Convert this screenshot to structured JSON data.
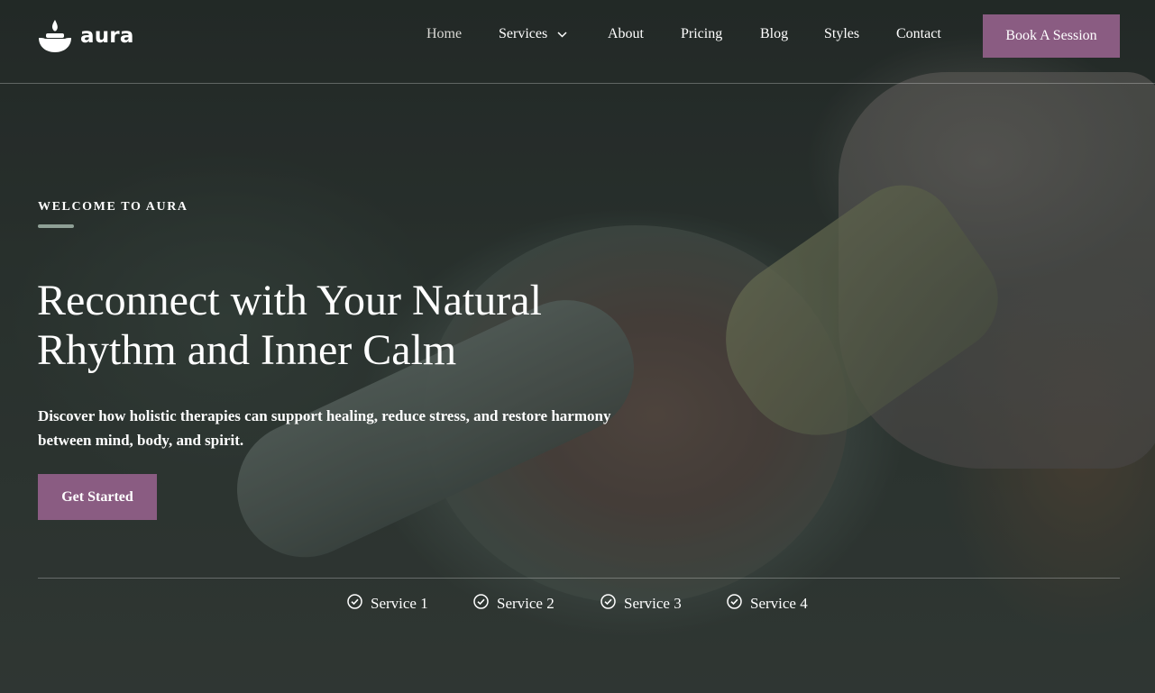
{
  "brand": {
    "name": "aura",
    "logo_icon": "candle-bowl-icon"
  },
  "nav": {
    "items": [
      {
        "label": "Home",
        "active": true
      },
      {
        "label": "Services",
        "has_dropdown": true
      },
      {
        "label": "About"
      },
      {
        "label": "Pricing"
      },
      {
        "label": "Blog"
      },
      {
        "label": "Styles"
      },
      {
        "label": "Contact"
      }
    ],
    "cta_label": "Book A Session"
  },
  "hero": {
    "eyebrow": "WELCOME TO AURA",
    "headline_line1": "Reconnect with Your Natural",
    "headline_line2": "Rhythm and Inner Calm",
    "subtext_line1": "Discover how holistic therapies can support healing, reduce stress, and restore harmony",
    "subtext_line2": "between mind, body, and spirit.",
    "button_label": "Get Started"
  },
  "services": [
    {
      "label": "Service 1",
      "icon": "check-circle-icon"
    },
    {
      "label": "Service 2",
      "icon": "check-circle-icon"
    },
    {
      "label": "Service 3",
      "icon": "check-circle-icon"
    },
    {
      "label": "Service 4",
      "icon": "check-circle-icon"
    }
  ],
  "colors": {
    "accent": "#8a5c82",
    "eyebrow_underline": "#8fa096",
    "text": "#ffffff",
    "background": "#2a302c"
  }
}
